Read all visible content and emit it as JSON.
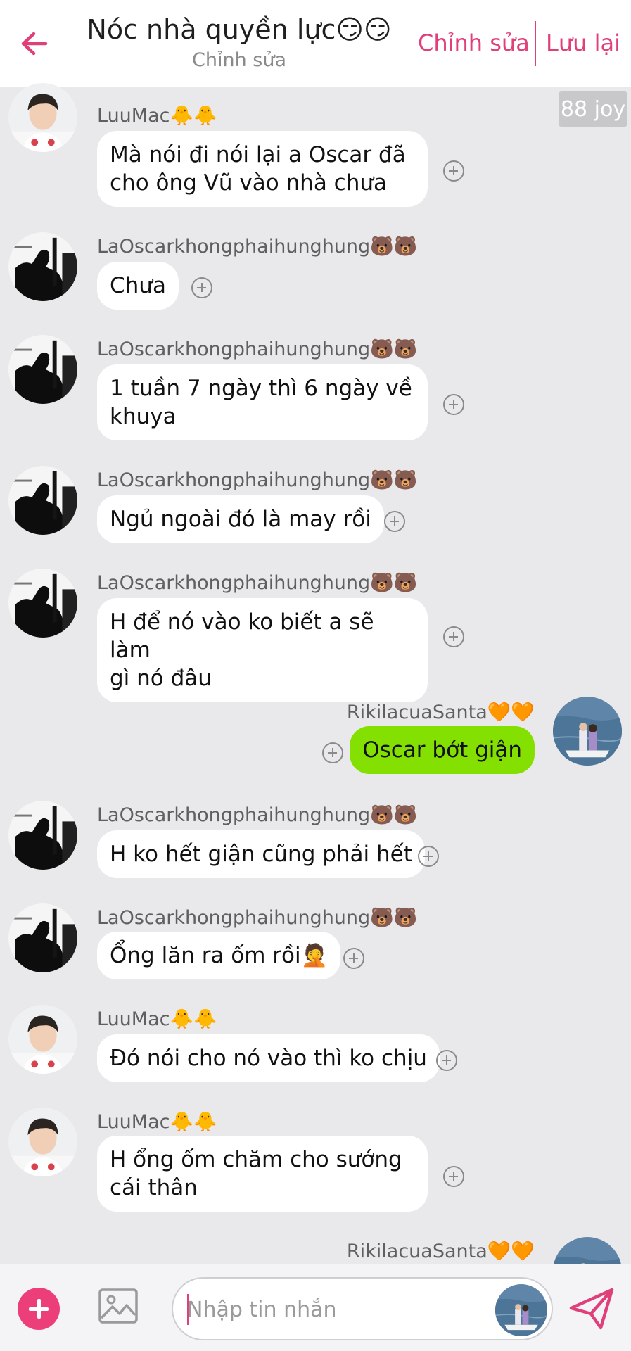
{
  "header": {
    "title": "Nóc nhà quyền lực😏😏",
    "subtitle": "Chỉnh sửa",
    "edit_label": "Chỉnh sửa",
    "save_label": "Lưu lại"
  },
  "joy_badge": "88 joy",
  "messages": [
    {
      "sender": "LuuMac🐥🐥",
      "text": "Mà nói đi nói lại a Oscar đã\ncho ông Vũ vào nhà chưa",
      "avatar": "boy-avatar",
      "direction": "in"
    },
    {
      "sender": "LaOscarkhongphaihunghung🐻🐻",
      "text": "Chưa",
      "avatar": "silhouette-avatar",
      "direction": "in"
    },
    {
      "sender": "LaOscarkhongphaihunghung🐻🐻",
      "text": "1 tuần 7 ngày thì 6 ngày về\nkhuya",
      "avatar": "silhouette-avatar",
      "direction": "in"
    },
    {
      "sender": "LaOscarkhongphaihunghung🐻🐻",
      "text": "Ngủ ngoài đó là may rồi",
      "avatar": "silhouette-avatar",
      "direction": "in"
    },
    {
      "sender": "LaOscarkhongphaihunghung🐻🐻",
      "text": "H để nó vào ko biết a sẽ làm\ngì nó đâu",
      "avatar": "silhouette-avatar",
      "direction": "in"
    },
    {
      "sender": "RikilacuaSanta🧡🧡",
      "text": "Oscar bớt giận",
      "avatar": "sea-avatar",
      "direction": "out"
    },
    {
      "sender": "LaOscarkhongphaihunghung🐻🐻",
      "text": "H ko hết giận cũng phải hết",
      "avatar": "silhouette-avatar",
      "direction": "in"
    },
    {
      "sender": "LaOscarkhongphaihunghung🐻🐻",
      "text": "Ổng lăn ra ốm rồi🤦",
      "avatar": "silhouette-avatar",
      "direction": "in"
    },
    {
      "sender": "LuuMac🐥🐥",
      "text": "Đó nói cho nó vào thì ko chịu",
      "avatar": "boy-avatar",
      "direction": "in"
    },
    {
      "sender": "LuuMac🐥🐥",
      "text": "H ổng ốm chăm cho sướng\ncái thân",
      "avatar": "boy-avatar",
      "direction": "in"
    },
    {
      "sender": "RikilacuaSanta🧡🧡",
      "text": "",
      "avatar": "sea-avatar",
      "direction": "out"
    }
  ],
  "composer": {
    "placeholder": "Nhập tin nhắn"
  },
  "colors": {
    "accent": "#e0407a",
    "outgoing_bubble": "#84e000",
    "incoming_bubble": "#ffffff",
    "background": "#e9e9ec"
  },
  "icons": [
    "back-arrow-icon",
    "add-reaction-icon",
    "plus-icon",
    "image-icon",
    "send-icon"
  ]
}
